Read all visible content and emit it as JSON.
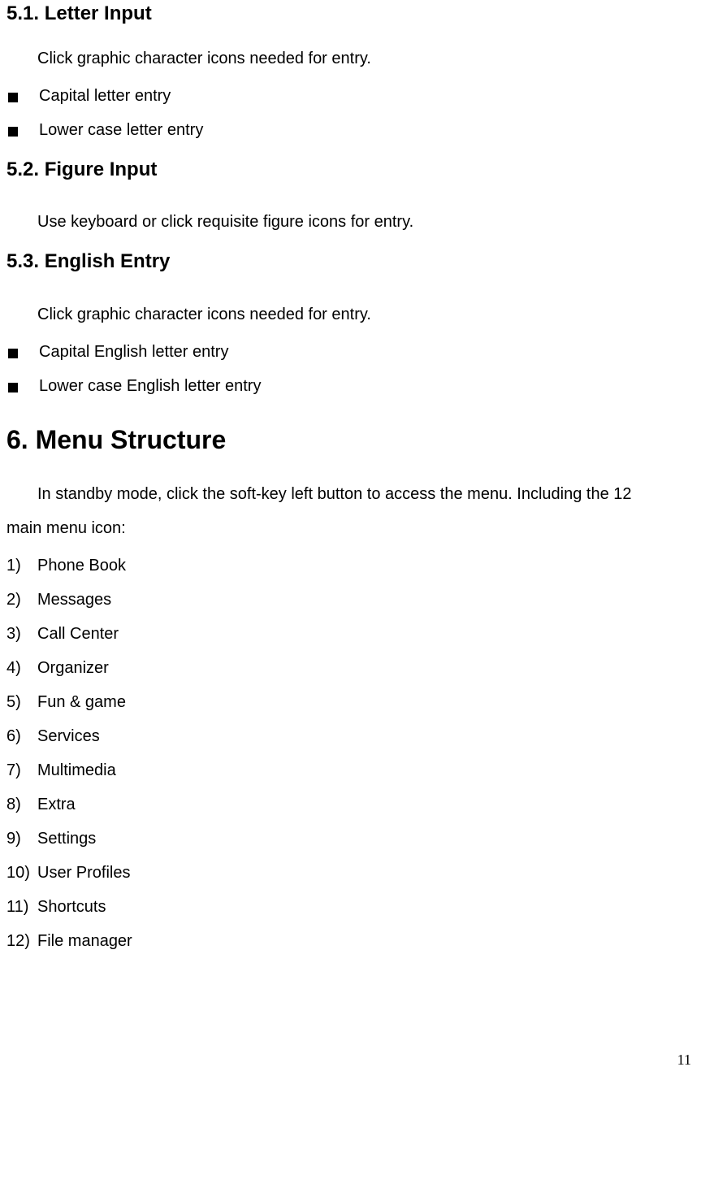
{
  "sections": {
    "s51": {
      "heading": "5.1. Letter Input",
      "intro": "Click graphic character icons needed for entry.",
      "bullets": [
        "Capital letter entry",
        "Lower case letter entry"
      ]
    },
    "s52": {
      "heading": "5.2. Figure Input",
      "intro": "Use keyboard or click requisite figure icons for entry."
    },
    "s53": {
      "heading": "5.3. English Entry",
      "intro": "Click graphic character icons needed for entry.",
      "bullets": [
        "Capital English letter entry",
        "Lower case English letter entry"
      ]
    }
  },
  "chapter6": {
    "heading": "6. Menu Structure",
    "intro": "In standby mode, click the soft-key left button to access the menu. Including the 12",
    "intro2": "main menu icon:",
    "items": [
      {
        "marker": "1)",
        "label": "Phone Book"
      },
      {
        "marker": "2)",
        "label": "Messages"
      },
      {
        "marker": "3)",
        "label": "Call Center"
      },
      {
        "marker": "4)",
        "label": "Organizer"
      },
      {
        "marker": "5)",
        "label": "Fun & game"
      },
      {
        "marker": "6)",
        "label": "Services"
      },
      {
        "marker": "7)",
        "label": "Multimedia"
      },
      {
        "marker": "8)",
        "label": "Extra"
      },
      {
        "marker": "9)",
        "label": "Settings"
      },
      {
        "marker": "10)",
        "label": "User Profiles"
      },
      {
        "marker": "11)",
        "label": "Shortcuts"
      },
      {
        "marker": "12)",
        "label": "File manager"
      }
    ]
  },
  "page_number": "11"
}
